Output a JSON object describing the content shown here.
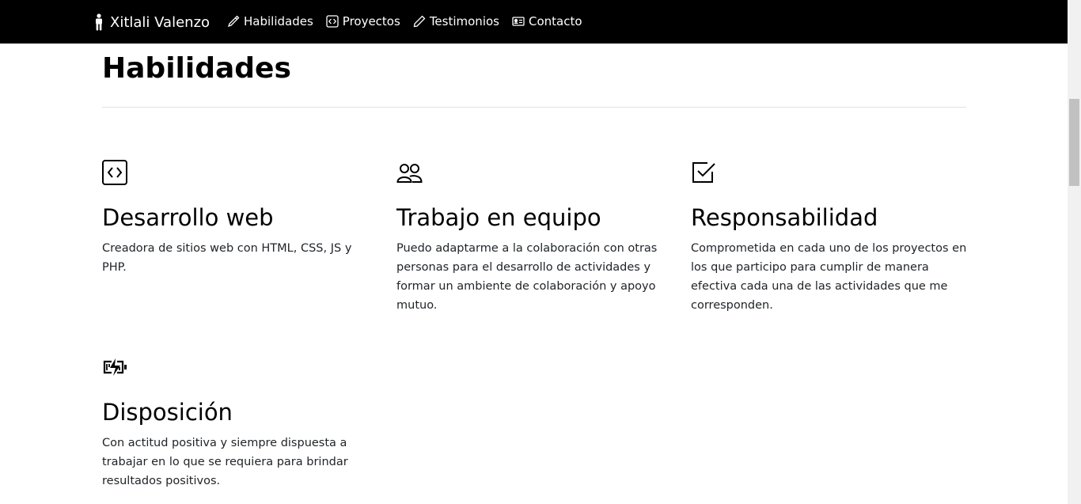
{
  "navbar": {
    "brand": "Xitlali Valenzo",
    "links": [
      {
        "label": "Habilidades",
        "icon": "pencil-icon"
      },
      {
        "label": "Proyectos",
        "icon": "code-square-icon"
      },
      {
        "label": "Testimonios",
        "icon": "pen-icon"
      },
      {
        "label": "Contacto",
        "icon": "person-card-icon"
      }
    ]
  },
  "section": {
    "title": "Habilidades"
  },
  "skills": [
    {
      "icon": "code-square-icon",
      "title": "Desarrollo web",
      "description": "Creadora de sitios web con HTML, CSS, JS y PHP."
    },
    {
      "icon": "people-icon",
      "title": "Trabajo en equipo",
      "description": "Puedo adaptarme a la colaboración con otras personas para el desarrollo de actividades y formar un ambiente de colaboración y apoyo mutuo."
    },
    {
      "icon": "check-square-icon",
      "title": "Responsabilidad",
      "description": "Comprometida en cada uno de los proyectos en los que participo para cumplir de manera efectiva cada una de las actividades que me corresponden."
    },
    {
      "icon": "battery-charging-icon",
      "title": "Disposición",
      "description": "Con actitud positiva y siempre dispuesta a trabajar en lo que se requiera para brindar resultados positivos."
    }
  ],
  "colors": {
    "navbar_bg": "#000000",
    "text": "#212529",
    "heading": "#000000"
  }
}
